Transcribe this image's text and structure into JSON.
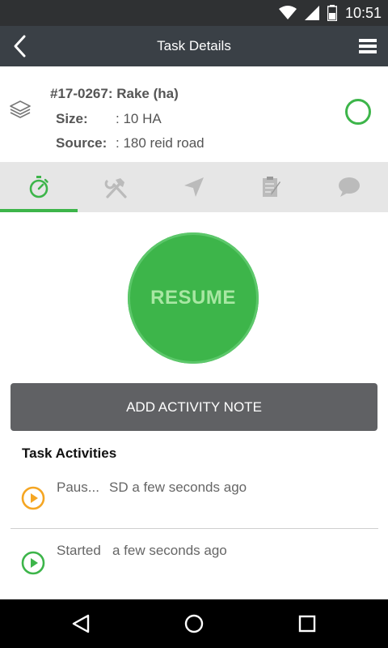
{
  "status_bar": {
    "time": "10:51",
    "icons": [
      "wifi-icon",
      "cell-signal-icon",
      "battery-icon"
    ]
  },
  "app_bar": {
    "title": "Task Details",
    "back_icon": "back-arrow-icon",
    "menu_icon": "hamburger-menu-icon"
  },
  "task": {
    "title": "#17-0267: Rake (ha)",
    "size_label": "Size:",
    "size_value": ": 10 HA",
    "source_label": "Source:",
    "source_value": ": 180 reid road",
    "type_icon": "layers-icon",
    "status_icon": "status-circle-icon"
  },
  "tabs": [
    {
      "name": "timer",
      "icon": "stopwatch-icon",
      "active": true
    },
    {
      "name": "tools",
      "icon": "hammer-wrench-icon",
      "active": false
    },
    {
      "name": "navigate",
      "icon": "navigation-arrow-icon",
      "active": false
    },
    {
      "name": "checklist",
      "icon": "clipboard-checklist-icon",
      "active": false
    },
    {
      "name": "comments",
      "icon": "chat-bubble-icon",
      "active": false
    }
  ],
  "resume_button": {
    "label": "RESUME"
  },
  "note_button": {
    "label": "ADD ACTIVITY NOTE"
  },
  "activities": {
    "heading": "Task Activities",
    "items": [
      {
        "name": "Paus...",
        "time": "SD a few seconds ago",
        "icon": "play-circle-icon",
        "color": "#f5a623"
      },
      {
        "name": "Started",
        "time": "a few seconds ago",
        "icon": "play-circle-icon",
        "color": "#3db54a"
      }
    ]
  },
  "colors": {
    "accent_green": "#3db54a",
    "pause_orange": "#f5a623",
    "header_dark": "#3a4046"
  },
  "nav_bar": {
    "icons": [
      "nav-back-icon",
      "nav-home-icon",
      "nav-recents-icon"
    ]
  }
}
